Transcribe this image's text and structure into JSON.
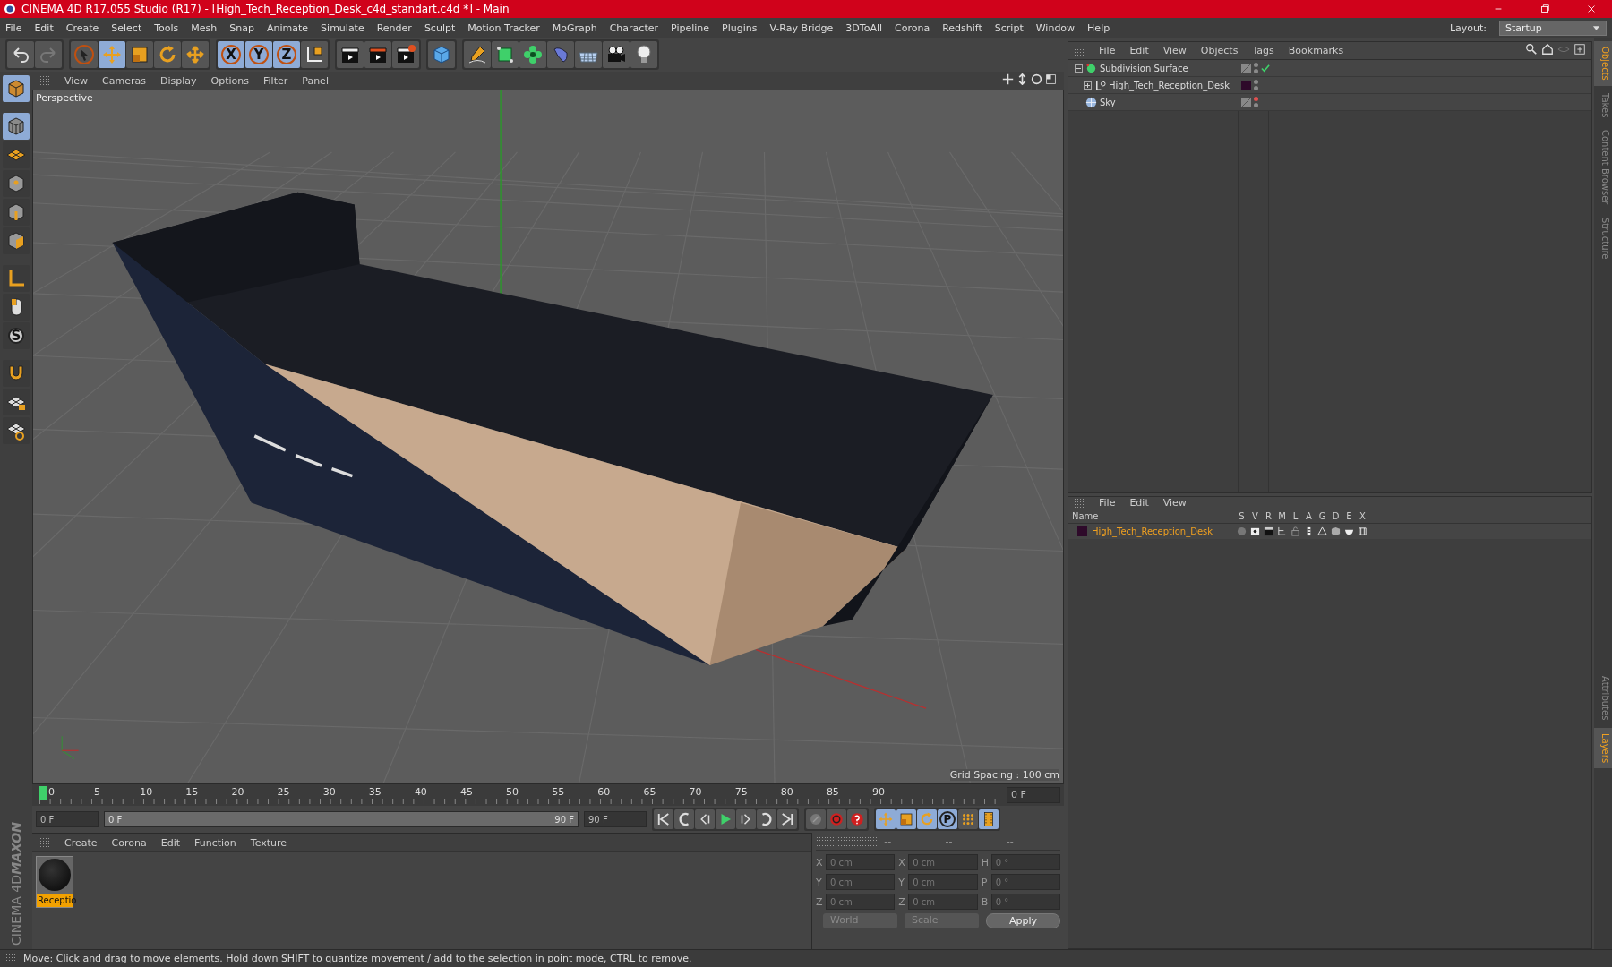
{
  "title_bar": {
    "title": "CINEMA 4D R17.055 Studio (R17) - [High_Tech_Reception_Desk_c4d_standart.c4d *] - Main"
  },
  "menu_bar": [
    "File",
    "Edit",
    "Create",
    "Select",
    "Tools",
    "Mesh",
    "Snap",
    "Animate",
    "Simulate",
    "Render",
    "Sculpt",
    "Motion Tracker",
    "MoGraph",
    "Character",
    "Pipeline",
    "Plugins",
    "V-Ray Bridge",
    "3DToAll",
    "Corona",
    "Redshift",
    "Script",
    "Window",
    "Help"
  ],
  "layout": {
    "label": "Layout:",
    "value": "Startup"
  },
  "toolbar": {
    "tools": [
      {
        "kind": "undo",
        "selected": false
      },
      {
        "kind": "redo",
        "selected": false
      },
      {
        "kind": "cursor",
        "selected": false
      },
      {
        "kind": "move",
        "selected": true
      },
      {
        "kind": "scale",
        "selected": false
      },
      {
        "kind": "rotate",
        "selected": false
      },
      {
        "kind": "axis-move",
        "selected": false
      }
    ],
    "axes": [
      {
        "label": "X",
        "selected": true
      },
      {
        "label": "Y",
        "selected": true
      },
      {
        "label": "Z",
        "selected": true
      }
    ],
    "tools_2": [
      {
        "kind": "coords",
        "selected": false
      },
      {
        "kind": "clapper",
        "selected": false
      },
      {
        "kind": "clapper-red",
        "selected": false
      },
      {
        "kind": "clapper-gear",
        "selected": false
      },
      {
        "kind": "cube",
        "selected": false
      },
      {
        "kind": "pen",
        "selected": false
      },
      {
        "kind": "subdiv",
        "selected": false
      },
      {
        "kind": "cloner",
        "selected": false
      },
      {
        "kind": "deformer",
        "selected": false
      },
      {
        "kind": "floor",
        "selected": false
      },
      {
        "kind": "camera",
        "selected": false
      },
      {
        "kind": "bulb",
        "selected": false
      }
    ]
  },
  "left_toolbar": {
    "tools": [
      {
        "kind": "model-cube",
        "selected": true
      },
      {
        "kind": "texture-cube",
        "selected": true
      },
      {
        "kind": "grid-plane",
        "selected": false
      },
      {
        "kind": "point-cube",
        "selected": false
      },
      {
        "kind": "edge-cube",
        "selected": false
      },
      {
        "kind": "poly-cube",
        "selected": false
      },
      {
        "kind": "axis-l",
        "selected": false
      },
      {
        "kind": "mouse",
        "selected": false
      }
    ],
    "s_label": "S",
    "tools_2": [
      {
        "kind": "magnet",
        "selected": false
      },
      {
        "kind": "lock-grid",
        "selected": false
      },
      {
        "kind": "grid-snap",
        "selected": false
      }
    ]
  },
  "viewport": {
    "menu": [
      "View",
      "Cameras",
      "Display",
      "Options",
      "Filter",
      "Panel"
    ],
    "camera_label": "Perspective",
    "grid_spacing": "Grid Spacing : 100 cm"
  },
  "timeline": {
    "ticks": [
      "0",
      "5",
      "10",
      "15",
      "20",
      "25",
      "30",
      "35",
      "40",
      "45",
      "50",
      "55",
      "60",
      "65",
      "70",
      "75",
      "80",
      "85",
      "90"
    ],
    "current_frame": "0 F",
    "start": "0 F",
    "range": {
      "start": "0 F",
      "end": "90 F",
      "level": 1
    },
    "end": "90 F",
    "controls": [
      {
        "kind": "first",
        "selected": false
      },
      {
        "kind": "prev-key",
        "selected": false
      },
      {
        "kind": "prev",
        "selected": false
      },
      {
        "kind": "play",
        "selected": false
      },
      {
        "kind": "next",
        "selected": false
      },
      {
        "kind": "next-key",
        "selected": false
      },
      {
        "kind": "last",
        "selected": false
      }
    ],
    "record": [
      {
        "kind": "key",
        "selected": false
      },
      {
        "kind": "record",
        "selected": false
      },
      {
        "kind": "help",
        "selected": false
      }
    ],
    "keys": [
      {
        "kind": "move",
        "selected": true
      },
      {
        "kind": "scale",
        "selected": true
      },
      {
        "kind": "rotate",
        "selected": true
      },
      {
        "kind": "p",
        "selected": true
      },
      {
        "kind": "dots",
        "selected": false
      },
      {
        "kind": "film",
        "selected": true
      }
    ],
    "p_label": "P"
  },
  "materials": {
    "menu": [
      "Create",
      "Corona",
      "Edit",
      "Function",
      "Texture"
    ],
    "items": [
      {
        "name": "Receptio",
        "selected": true
      }
    ]
  },
  "brand": {
    "company": "MAXON",
    "product": "CINEMA 4D"
  },
  "coordinates": {
    "headers": [
      "--",
      "--",
      "--"
    ],
    "rows": [
      [
        {
          "axis": "X",
          "value": "0 cm"
        },
        {
          "axis": "X",
          "value": "0 cm"
        },
        {
          "axis": "H",
          "value": "0 °"
        }
      ],
      [
        {
          "axis": "Y",
          "value": "0 cm"
        },
        {
          "axis": "Y",
          "value": "0 cm"
        },
        {
          "axis": "P",
          "value": "0 °"
        }
      ],
      [
        {
          "axis": "Z",
          "value": "0 cm"
        },
        {
          "axis": "Z",
          "value": "0 cm"
        },
        {
          "axis": "B",
          "value": "0 °"
        }
      ]
    ],
    "space": "World",
    "mode": "Scale",
    "apply": "Apply"
  },
  "object_manager": {
    "menu": [
      "File",
      "Edit",
      "View",
      "Objects",
      "Tags",
      "Bookmarks"
    ],
    "objects": [
      {
        "name": "Subdivision Surface",
        "kind": "subdiv",
        "expanded": true,
        "enabled": true,
        "visibility": [
          {
            "color": "#8a8a8a"
          },
          {
            "color": "#8a8a8a"
          }
        ],
        "children": [
          {
            "name": "High_Tech_Reception_Desk",
            "kind": "null",
            "expanded": false,
            "color": "#2e0a2a",
            "visibility": [
              {
                "color": "#8a8a8a"
              },
              {
                "color": "#8a8a8a"
              }
            ]
          }
        ]
      },
      {
        "name": "Sky",
        "kind": "sky",
        "visibility": [
          {
            "color": "#e05050"
          },
          {
            "color": "#8a8a8a"
          }
        ]
      }
    ]
  },
  "layer_manager": {
    "menu": [
      "File",
      "Edit",
      "View"
    ],
    "columns": [
      "Name",
      "S",
      "V",
      "R",
      "M",
      "L",
      "A",
      "G",
      "D",
      "E",
      "X"
    ],
    "layers": [
      {
        "name": "High_Tech_Reception_Desk",
        "color": "#2e0a2a"
      }
    ]
  },
  "side_tabs": {
    "top": [
      {
        "label": "Objects",
        "selected": true
      },
      {
        "label": "Takes",
        "selected": false
      },
      {
        "label": "Content Browser",
        "selected": false
      },
      {
        "label": "Structure",
        "selected": false
      }
    ],
    "bottom": [
      {
        "label": "Attributes",
        "selected": false
      },
      {
        "label": "Layers",
        "selected": true
      }
    ]
  },
  "status_bar": "Move: Click and drag to move elements. Hold down SHIFT to quantize movement / add to the selection in point mode, CTRL to remove."
}
